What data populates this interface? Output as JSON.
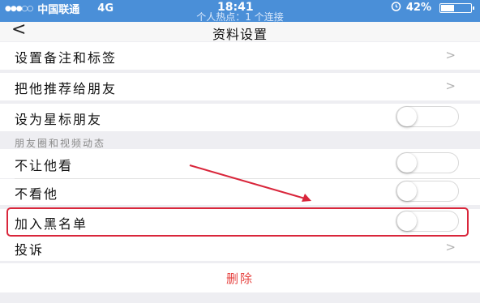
{
  "status_bar": {
    "carrier": "中国联通",
    "network": "4G",
    "time": "18:41",
    "hotspot_text": "个人热点：1 个连接",
    "alarm_icon": "alarm-icon",
    "battery_text": "42%",
    "battery_level": 0.42
  },
  "navbar": {
    "back_glyph": "<",
    "title": "资料设置"
  },
  "rows": {
    "remark": {
      "label": "设置备注和标签",
      "chevron": ">"
    },
    "recommend": {
      "label": "把他推荐给朋友",
      "chevron": ">"
    },
    "star": {
      "label": "设为星标朋友",
      "toggle_on": false
    },
    "moments_header": "朋友圈和视频动态",
    "hide_mine": {
      "label": "不让他看",
      "toggle_on": false
    },
    "hide_his": {
      "label": "不看他",
      "toggle_on": false
    },
    "blacklist": {
      "label": "加入黑名单",
      "toggle_on": false
    },
    "report": {
      "label": "投诉",
      "chevron": ">"
    }
  },
  "delete": {
    "label": "删除"
  },
  "colors": {
    "status_bar": "#4a8fd8",
    "delete_text": "#e64340",
    "annotation_red": "#d9263b"
  }
}
